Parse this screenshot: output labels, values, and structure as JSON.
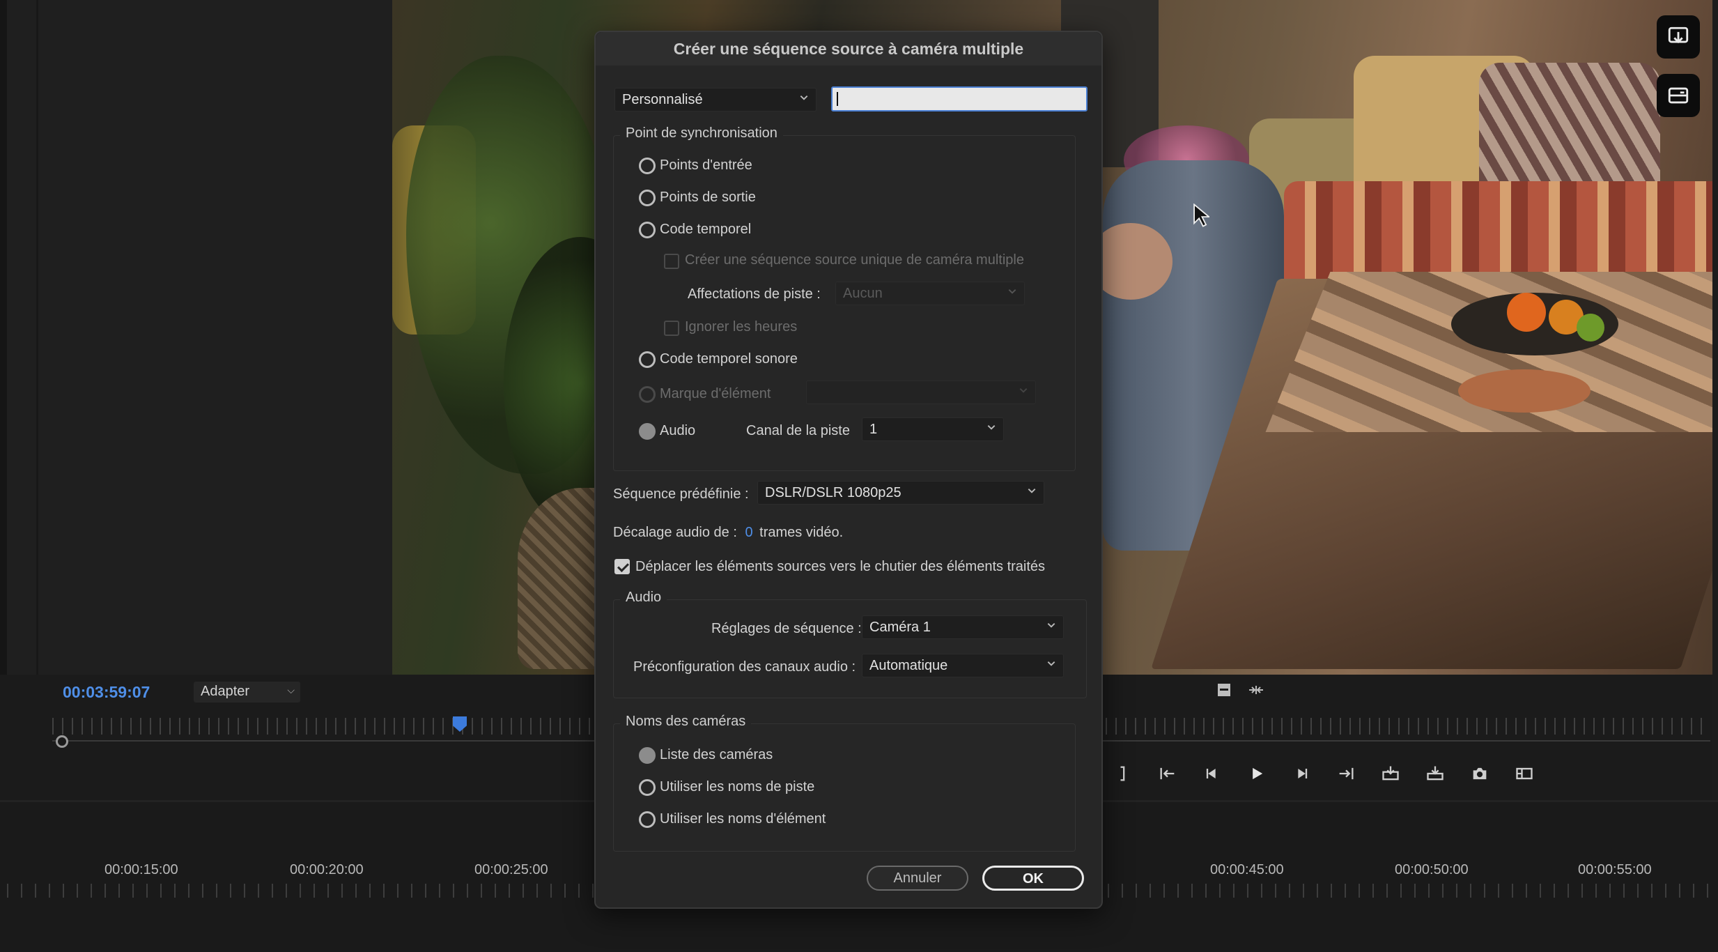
{
  "monitor": {
    "timecode": "00:03:59:07",
    "fit_label": "Adapter"
  },
  "timeline": {
    "labels": [
      "00:00:15:00",
      "00:00:20:00",
      "00:00:25:00",
      "00:00:45:00",
      "00:00:50:00",
      "00:00:55:00"
    ]
  },
  "dialog": {
    "title": "Créer une séquence source à caméra multiple",
    "preset_select": "Personnalisé",
    "name_value": "",
    "sync": {
      "title": "Point de synchronisation",
      "in_points": "Points d'entrée",
      "out_points": "Points de sortie",
      "timecode": "Code temporel",
      "single_seq": "Créer une séquence source unique de caméra multiple",
      "track_assign_label": "Affectations de piste :",
      "track_assign_value": "Aucun",
      "ignore_hours": "Ignorer les heures",
      "audio_timecode": "Code temporel sonore",
      "clip_marker": "Marque d'élément",
      "audio": "Audio",
      "track_channel_label": "Canal de la piste",
      "track_channel_value": "1"
    },
    "preset_seq_label": "Séquence prédéfinie :",
    "preset_seq_value": "DSLR/DSLR 1080p25",
    "audio_offset_label": "Décalage audio de :",
    "audio_offset_value": "0",
    "audio_offset_unit": "trames vidéo.",
    "move_sources_label": "Déplacer les éléments sources vers le chutier des éléments traités",
    "audio_group": {
      "title": "Audio",
      "seq_settings_label": "Réglages de séquence :",
      "seq_settings_value": "Caméra 1",
      "channel_preset_label": "Préconfiguration des canaux audio :",
      "channel_preset_value": "Automatique"
    },
    "camera_names": {
      "title": "Noms des caméras",
      "camera_list": "Liste des caméras",
      "track_names": "Utiliser les noms de piste",
      "clip_names": "Utiliser les noms d'élément"
    },
    "cancel_label": "Annuler",
    "ok_label": "OK"
  }
}
